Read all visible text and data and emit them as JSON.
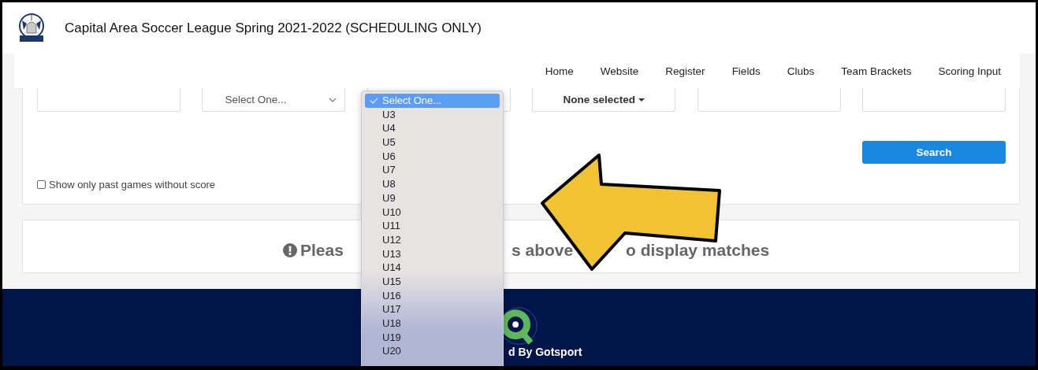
{
  "header": {
    "title": "Capital Area Soccer League Spring 2021-2022 (SCHEDULING ONLY)"
  },
  "nav": [
    "Home",
    "Website",
    "Register",
    "Fields",
    "Clubs",
    "Team Brackets",
    "Scoring Input"
  ],
  "filters": {
    "select_1": "Select One...",
    "multiselect": "None selected",
    "search_button": "Search",
    "past_games_checkbox": {
      "label": "Show only past games without score",
      "checked": false
    }
  },
  "message_parts": [
    "Pleas",
    "s above",
    "o display matches"
  ],
  "footer": {
    "powered_by": "d By Gotsport"
  },
  "age_dropdown": {
    "options": [
      {
        "label": "Select One...",
        "selected": true
      },
      {
        "label": "U3",
        "selected": false
      },
      {
        "label": "U4",
        "selected": false
      },
      {
        "label": "U5",
        "selected": false
      },
      {
        "label": "U6",
        "selected": false
      },
      {
        "label": "U7",
        "selected": false
      },
      {
        "label": "U8",
        "selected": false
      },
      {
        "label": "U9",
        "selected": false
      },
      {
        "label": "U10",
        "selected": false
      },
      {
        "label": "U11",
        "selected": false
      },
      {
        "label": "U12",
        "selected": false
      },
      {
        "label": "U13",
        "selected": false
      },
      {
        "label": "U14",
        "selected": false
      },
      {
        "label": "U15",
        "selected": false
      },
      {
        "label": "U16",
        "selected": false
      },
      {
        "label": "U17",
        "selected": false
      },
      {
        "label": "U18",
        "selected": false
      },
      {
        "label": "U19",
        "selected": false
      },
      {
        "label": "U20",
        "selected": false
      }
    ]
  }
}
